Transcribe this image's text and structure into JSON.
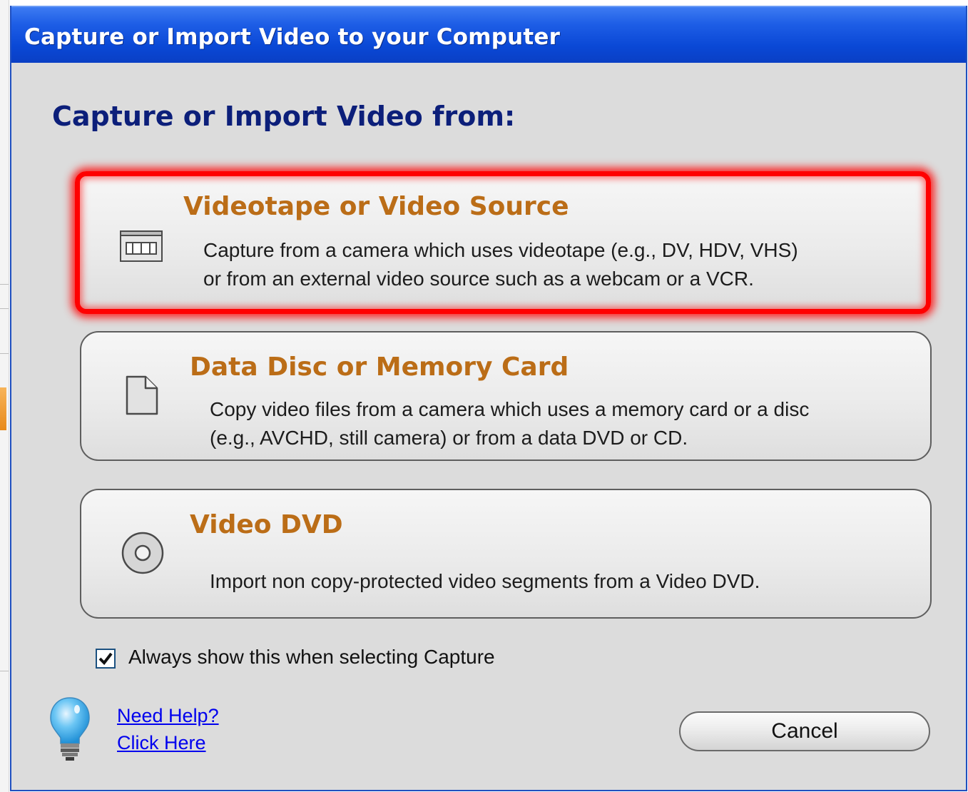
{
  "window": {
    "title": "Capture or Import Video to your Computer"
  },
  "heading": "Capture or Import Video from:",
  "options": [
    {
      "title": "Videotape or Video Source",
      "desc_line1": "Capture from a camera which uses videotape (e.g., DV, HDV, VHS)",
      "desc_line2": "or from an external video source such as a webcam or a VCR.",
      "icon": "videotape-icon",
      "selected": true
    },
    {
      "title": "Data Disc or Memory Card",
      "desc_line1": "Copy video files from a camera which uses a memory card or a disc",
      "desc_line2": "(e.g., AVCHD, still camera) or from a data DVD or CD.",
      "icon": "document-icon",
      "selected": false
    },
    {
      "title": "Video DVD",
      "desc_line1": "Import non copy-protected video segments from a Video DVD.",
      "icon": "disc-icon",
      "selected": false
    }
  ],
  "always_show": {
    "label": "Always show this when selecting Capture",
    "checked": true
  },
  "help": {
    "line1": "Need Help?",
    "line2": "Click Here"
  },
  "cancel_label": "Cancel",
  "colors": {
    "titlebar": "#0a48d6",
    "heading": "#0c1f7a",
    "option_title": "#bb6d17",
    "selection_highlight": "#ff0000",
    "link": "#0000ee"
  }
}
